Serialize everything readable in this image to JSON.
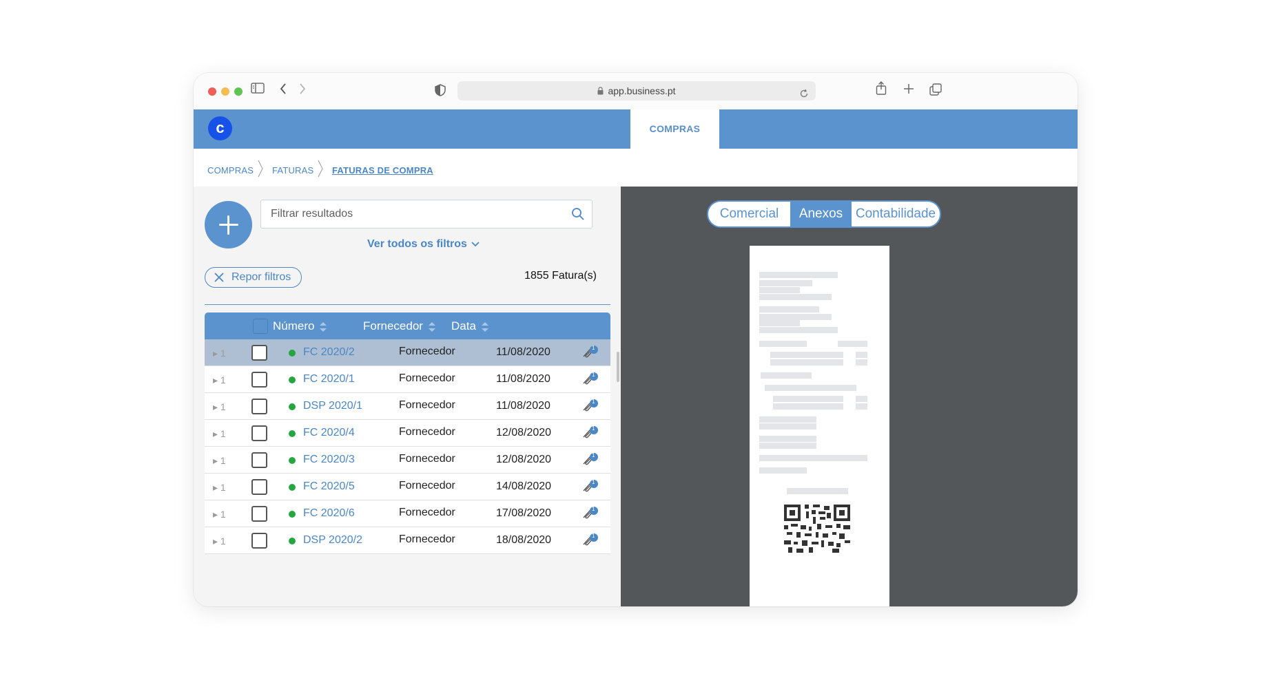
{
  "browser": {
    "url": "app.business.pt"
  },
  "app": {
    "logo_letter": "c",
    "active_tab": "COMPRAS"
  },
  "breadcrumb": [
    "COMPRAS",
    "FATURAS",
    "FATURAS DE COMPRA"
  ],
  "filters": {
    "search_placeholder": "Filtrar resultados",
    "all_filters_label": "Ver todos os filtros",
    "reset_label": "Repor filtros",
    "count_label": "1855 Fatura(s)"
  },
  "table": {
    "headers": {
      "number": "Número",
      "supplier": "Fornecedor",
      "date": "Data"
    },
    "rows": [
      {
        "lines": "1",
        "number": "FC 2020/2",
        "supplier": "Fornecedor",
        "date": "11/08/2020",
        "attachments": "1",
        "selected": true
      },
      {
        "lines": "1",
        "number": "FC 2020/1",
        "supplier": "Fornecedor",
        "date": "11/08/2020",
        "attachments": "1"
      },
      {
        "lines": "1",
        "number": "DSP 2020/1",
        "supplier": "Fornecedor",
        "date": "11/08/2020",
        "attachments": "1"
      },
      {
        "lines": "1",
        "number": "FC 2020/4",
        "supplier": "Fornecedor",
        "date": "12/08/2020",
        "attachments": "1"
      },
      {
        "lines": "1",
        "number": "FC 2020/3",
        "supplier": "Fornecedor",
        "date": "12/08/2020",
        "attachments": "1"
      },
      {
        "lines": "1",
        "number": "FC 2020/5",
        "supplier": "Fornecedor",
        "date": "14/08/2020",
        "attachments": "1"
      },
      {
        "lines": "1",
        "number": "FC 2020/6",
        "supplier": "Fornecedor",
        "date": "17/08/2020",
        "attachments": "1"
      },
      {
        "lines": "1",
        "number": "DSP 2020/2",
        "supplier": "Fornecedor",
        "date": "18/08/2020",
        "attachments": "1"
      }
    ]
  },
  "preview": {
    "tabs": [
      "Comercial",
      "Anexos",
      "Contabilidade"
    ],
    "active_tab": "Anexos"
  },
  "colors": {
    "brand": "#5b93ce",
    "logo": "#1652e8",
    "status_ok": "#27a640",
    "preview_bg": "#53575a"
  },
  "icons": [
    "sidebar-icon",
    "back-icon",
    "forward-icon",
    "shield-icon",
    "lock-icon",
    "reload-icon",
    "share-icon",
    "plus-icon",
    "tabs-icon",
    "search-icon",
    "chevron-down-icon",
    "close-icon",
    "sort-icon",
    "paperclip-icon",
    "qr-code-icon"
  ]
}
